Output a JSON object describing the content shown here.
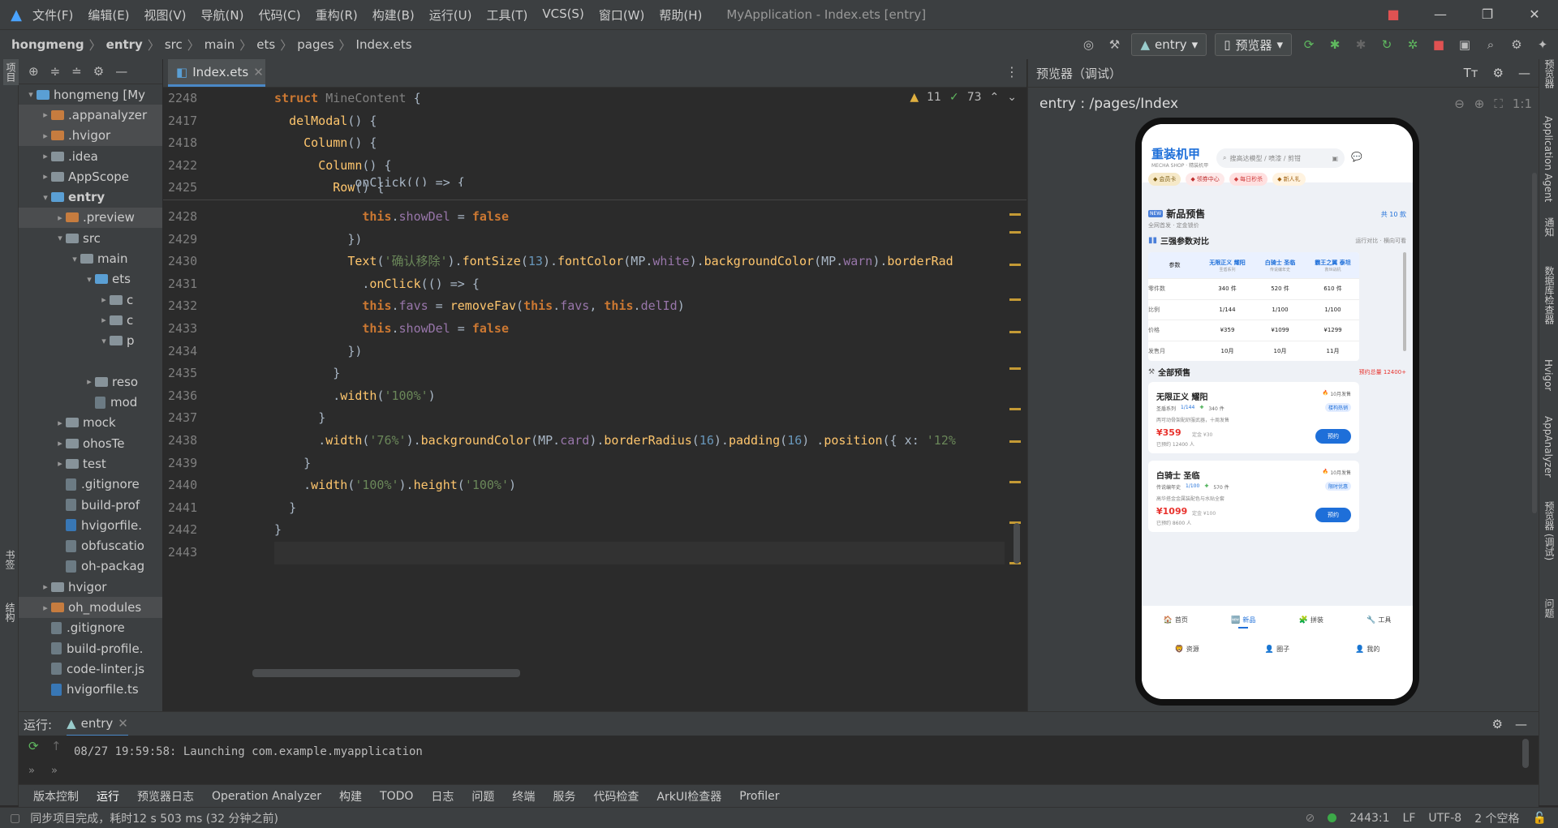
{
  "titlebar": {
    "menu": [
      "文件(F)",
      "编辑(E)",
      "视图(V)",
      "导航(N)",
      "代码(C)",
      "重构(R)",
      "构建(B)",
      "运行(U)",
      "工具(T)",
      "VCS(S)",
      "窗口(W)",
      "帮助(H)"
    ],
    "window_title": "MyApplication - Index.ets [entry]"
  },
  "breadcrumb": [
    "hongmeng",
    "entry",
    "src",
    "main",
    "ets",
    "pages",
    "Index.ets"
  ],
  "toolbar": {
    "module_select": "entry",
    "device_select": "预览器"
  },
  "left_strip": {
    "top_label": "项目",
    "bottom_label1": "书签",
    "bottom_label2": "结构"
  },
  "project_tree": [
    {
      "label": "hongmeng [My",
      "depth": 0,
      "arrow": "▾",
      "icon": "module",
      "bold": false
    },
    {
      "label": ".appanalyzer",
      "depth": 1,
      "arrow": "▸",
      "icon": "orange",
      "sel": true
    },
    {
      "label": ".hvigor",
      "depth": 1,
      "arrow": "▸",
      "icon": "orange",
      "sel": true
    },
    {
      "label": ".idea",
      "depth": 1,
      "arrow": "▸",
      "icon": "blue"
    },
    {
      "label": "AppScope",
      "depth": 1,
      "arrow": "▸",
      "icon": "blue"
    },
    {
      "label": "entry",
      "depth": 1,
      "arrow": "▾",
      "icon": "module",
      "bold": true
    },
    {
      "label": ".preview",
      "depth": 2,
      "arrow": "▸",
      "icon": "orange",
      "sel": true
    },
    {
      "label": "src",
      "depth": 2,
      "arrow": "▾",
      "icon": "blue"
    },
    {
      "label": "main",
      "depth": 3,
      "arrow": "▾",
      "icon": "blue"
    },
    {
      "label": "ets",
      "depth": 4,
      "arrow": "▾",
      "icon": "module"
    },
    {
      "label": "c",
      "depth": 5,
      "arrow": "▸",
      "icon": "blue"
    },
    {
      "label": "c",
      "depth": 5,
      "arrow": "▸",
      "icon": "blue"
    },
    {
      "label": "p",
      "depth": 5,
      "arrow": "▾",
      "icon": "blue"
    },
    {
      "label": "",
      "depth": 5,
      "arrow": "",
      "icon": ""
    },
    {
      "label": "reso",
      "depth": 4,
      "arrow": "▸",
      "icon": "blue"
    },
    {
      "label": "mod",
      "depth": 4,
      "arrow": "",
      "icon": "file"
    },
    {
      "label": "mock",
      "depth": 2,
      "arrow": "▸",
      "icon": "blue"
    },
    {
      "label": "ohosTe",
      "depth": 2,
      "arrow": "▸",
      "icon": "blue"
    },
    {
      "label": "test",
      "depth": 2,
      "arrow": "▸",
      "icon": "blue"
    },
    {
      "label": ".gitignore",
      "depth": 2,
      "arrow": "",
      "icon": "file"
    },
    {
      "label": "build-prof",
      "depth": 2,
      "arrow": "",
      "icon": "file"
    },
    {
      "label": "hvigorfile.",
      "depth": 2,
      "arrow": "",
      "icon": "ts"
    },
    {
      "label": "obfuscatio",
      "depth": 2,
      "arrow": "",
      "icon": "file"
    },
    {
      "label": "oh-packag",
      "depth": 2,
      "arrow": "",
      "icon": "file"
    },
    {
      "label": "hvigor",
      "depth": 1,
      "arrow": "▸",
      "icon": "blue"
    },
    {
      "label": "oh_modules",
      "depth": 1,
      "arrow": "▸",
      "icon": "orange",
      "sel": true
    },
    {
      "label": ".gitignore",
      "depth": 1,
      "arrow": "",
      "icon": "file"
    },
    {
      "label": "build-profile.",
      "depth": 1,
      "arrow": "",
      "icon": "file"
    },
    {
      "label": "code-linter.js",
      "depth": 1,
      "arrow": "",
      "icon": "file"
    },
    {
      "label": "hvigorfile.ts",
      "depth": 1,
      "arrow": "",
      "icon": "ts"
    }
  ],
  "editor": {
    "tab": "Index.ets",
    "inspection": {
      "warnings": "11",
      "ok": "73"
    },
    "sticky_lines": [
      {
        "num": "2248",
        "html": "<span class='kw'>struct</span> <span class='plain' style='color:#808080'>MineContent</span> <span class='plain'>{</span>"
      },
      {
        "num": "2417",
        "html": "  <span class='fn'>delModal</span><span class='plain'>() {</span>"
      },
      {
        "num": "2418",
        "html": "    <span class='fn'>Column</span><span class='plain'>() {</span>"
      },
      {
        "num": "2422",
        "html": "      <span class='fn'>Column</span><span class='plain'>() {</span>"
      },
      {
        "num": "2425",
        "html": "        <span class='fn'>Row</span><span class='plain'>() {</span>"
      }
    ],
    "lines": [
      {
        "num": "2428",
        "html": "            <span class='this'>this</span><span class='plain'>.</span><span class='prop'>showDel</span><span class='plain'> = </span><span class='kw'>false</span>"
      },
      {
        "num": "2429",
        "html": "          <span class='plain'>})</span>"
      },
      {
        "num": "2430",
        "html": "          <span class='fn'>Text</span><span class='plain'>(</span><span class='str'>'确认移除'</span><span class='plain'>).</span><span class='fn'>fontSize</span><span class='plain'>(</span><span class='num'>13</span><span class='plain'>).</span><span class='fn'>fontColor</span><span class='plain'>(MP.</span><span class='prop'>white</span><span class='plain'>).</span><span class='fn'>backgroundColor</span><span class='plain'>(MP.</span><span class='prop'>warn</span><span class='plain'>).</span><span class='fn'>borderRad</span>"
      },
      {
        "num": "2431",
        "html": "            <span class='plain'>.</span><span class='fn'>onClick</span><span class='plain'>(() => {</span>"
      },
      {
        "num": "2432",
        "html": "            <span class='this'>this</span><span class='plain'>.</span><span class='prop'>favs</span><span class='plain'> = </span><span class='fn'>removeFav</span><span class='plain'>(</span><span class='this'>this</span><span class='plain'>.</span><span class='prop'>favs</span><span class='plain'>, </span><span class='this'>this</span><span class='plain'>.</span><span class='prop'>delId</span><span class='plain'>)</span>"
      },
      {
        "num": "2433",
        "html": "            <span class='this'>this</span><span class='plain'>.</span><span class='prop'>showDel</span><span class='plain'> = </span><span class='kw'>false</span>"
      },
      {
        "num": "2434",
        "html": "          <span class='plain'>})</span>"
      },
      {
        "num": "2435",
        "html": "        <span class='plain'>}</span>"
      },
      {
        "num": "2436",
        "html": "        <span class='plain'>.</span><span class='fn'>width</span><span class='plain'>(</span><span class='str'>'100%'</span><span class='plain'>)</span>"
      },
      {
        "num": "2437",
        "html": "      <span class='plain'>}</span>"
      },
      {
        "num": "2438",
        "html": "      <span class='plain'>.</span><span class='fn'>width</span><span class='plain'>(</span><span class='str'>'76%'</span><span class='plain'>).</span><span class='fn'>backgroundColor</span><span class='plain'>(MP.</span><span class='prop'>card</span><span class='plain'>).</span><span class='fn'>borderRadius</span><span class='plain'>(</span><span class='num'>16</span><span class='plain'>).</span><span class='fn'>padding</span><span class='plain'>(</span><span class='num'>16</span><span class='plain'>) .</span><span class='fn'>position</span><span class='plain'>({ x: </span><span class='str'>'12%</span>"
      },
      {
        "num": "2439",
        "html": "    <span class='plain'>}</span>"
      },
      {
        "num": "2440",
        "html": "    <span class='plain'>.</span><span class='fn'>width</span><span class='plain'>(</span><span class='str'>'100%'</span><span class='plain'>).</span><span class='fn'>height</span><span class='plain'>(</span><span class='str'>'100%'</span><span class='plain'>)</span>"
      },
      {
        "num": "2441",
        "html": "  <span class='plain'>}</span>"
      },
      {
        "num": "2442",
        "html": "<span class='plain'>}</span>"
      },
      {
        "num": "2443",
        "html": ""
      }
    ],
    "partial_line": "          .onClick(() => {"
  },
  "preview": {
    "title": "预览器（调试）",
    "route": "entry : /pages/Index",
    "app": {
      "brand": "重装机甲",
      "brand_sub": "MECHA SHOP · 精装机甲",
      "search_placeholder": "搜高达模型 / 喷漆 / 剪钳",
      "chips": [
        "会员卡",
        "领券中心",
        "每日秒杀",
        "新人礼"
      ],
      "presale_title": "新品预售",
      "presale_sub": "全网首发 · 定金锁价",
      "presale_count": "共 10 款",
      "compare_title": "三强参数对比",
      "compare_hint": "运行对比 · 横向可看",
      "table_headers": [
        {
          "name": "参数",
          "sub": ""
        },
        {
          "name": "无限正义 耀阳",
          "sub": "圣盾系列"
        },
        {
          "name": "白骑士 圣临",
          "sub": "传说编年史"
        },
        {
          "name": "霸王之翼 泰坦",
          "sub": "救世战机"
        }
      ],
      "table_rows": [
        [
          "零件数",
          "340 件",
          "520 件",
          "610 件"
        ],
        [
          "比例",
          "1/144",
          "1/100",
          "1/100"
        ],
        [
          "价格",
          "¥359",
          "¥1099",
          "¥1299"
        ],
        [
          "发售月",
          "10月",
          "10月",
          "11月"
        ]
      ],
      "all_title": "全部预售",
      "all_hint": "预约总量 12400+",
      "cards": [
        {
          "name": "无限正义 耀阳",
          "month": "10月发售",
          "series": "圣盾系列",
          "scale": "1/144",
          "parts": "340 件",
          "tag": "楼构热销",
          "desc": "两可动骨架配舒服武器，十周发售",
          "price": "¥359",
          "deposit": "定金 ¥30",
          "booked": "已预约 12400 人",
          "btn": "预约"
        },
        {
          "name": "白骑士 圣临",
          "month": "10月发售",
          "series": "传说编年史",
          "scale": "1/100",
          "parts": "570 件",
          "tag": "限时优惠",
          "desc": "高华搭金金属装配色与水贴全套",
          "price": "¥1099",
          "deposit": "定金 ¥100",
          "booked": "已预约 8600 人",
          "btn": "预约"
        }
      ],
      "nav": [
        "首页",
        "新品",
        "拼装",
        "工具",
        "资源",
        "圈子",
        "我的"
      ]
    }
  },
  "right_strip": [
    "预览器",
    "Application Agent",
    "通知",
    "数据库检查器",
    "Hvigor",
    "AppAnalyzer",
    "预览器 (调试)",
    "问题"
  ],
  "run_panel": {
    "label": "运行:",
    "tab": "entry",
    "log": "08/27 19:59:58: Launching com.example.myapplication"
  },
  "bottom_tabs": [
    "版本控制",
    "运行",
    "预览器日志",
    "Operation Analyzer",
    "构建",
    "TODO",
    "日志",
    "问题",
    "终端",
    "服务",
    "代码检查",
    "ArkUI检查器",
    "Profiler"
  ],
  "status": {
    "message": "同步项目完成，耗时12 s 503 ms (32 分钟之前)",
    "position": "2443:1",
    "line_sep": "LF",
    "encoding": "UTF-8",
    "indent": "2 个空格"
  },
  "colors": {
    "accent": "#1e6fd9",
    "price": "#e8322d",
    "warn": "#e8322d"
  }
}
